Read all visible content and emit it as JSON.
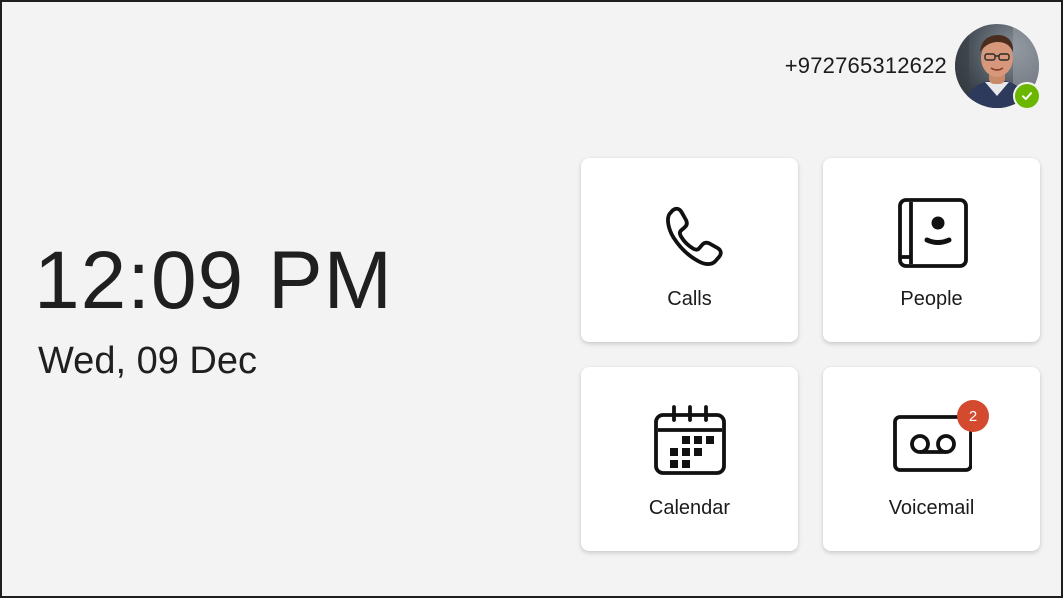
{
  "account": {
    "phone_number": "+972765312622",
    "presence_color": "#6bb700",
    "presence_icon": "check-icon"
  },
  "clock": {
    "time": "12:09 PM",
    "date": "Wed, 09 Dec"
  },
  "tiles": [
    {
      "label": "Calls",
      "icon": "phone-icon"
    },
    {
      "label": "People",
      "icon": "contacts-book-icon"
    },
    {
      "label": "Calendar",
      "icon": "calendar-icon"
    },
    {
      "label": "Voicemail",
      "icon": "voicemail-icon",
      "badge": "2",
      "badge_color": "#d34a2f"
    }
  ]
}
